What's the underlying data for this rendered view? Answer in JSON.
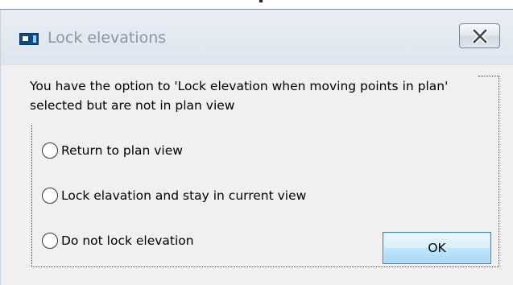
{
  "dialog": {
    "title": "Lock elevations",
    "close_icon": "close-x-icon",
    "app_icon": "app-window-icon",
    "message": "You have the option to 'Lock elevation when moving points in plan' selected but are not in plan view",
    "options": [
      {
        "label": "Return to plan view",
        "selected": false
      },
      {
        "label": "Lock elavation and stay in current view",
        "selected": false
      },
      {
        "label": "Do not lock elevation",
        "selected": false
      }
    ],
    "ok_label": "OK"
  },
  "colors": {
    "titlebar": "#dde5ee",
    "title_text": "#8c96a2",
    "content_bg": "#f0f0f0",
    "focus_dots": "#2e3dbf",
    "ok_button_border": "#3c7fb1"
  }
}
